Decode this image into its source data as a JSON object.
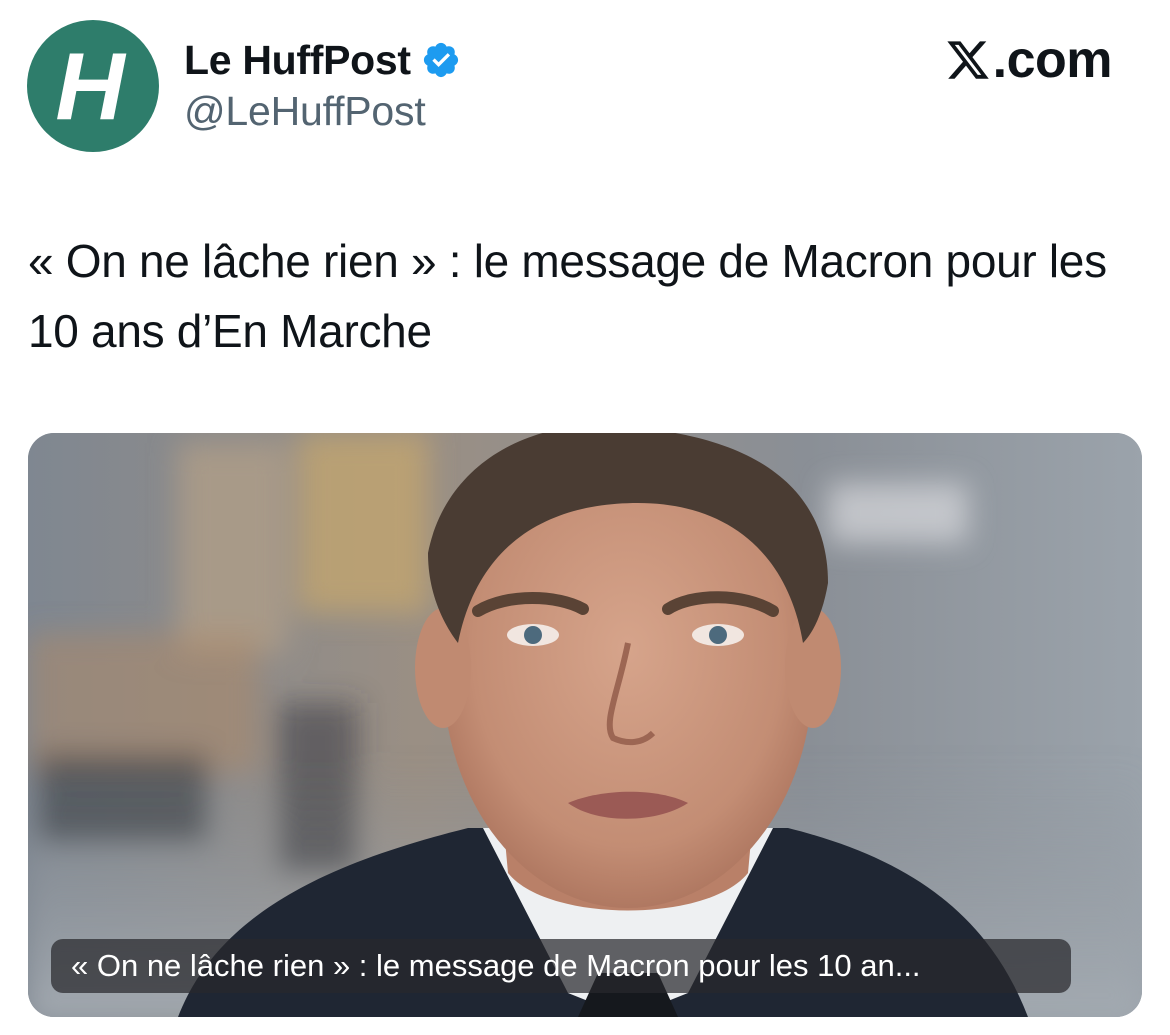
{
  "account": {
    "avatar_letter": "H",
    "avatar_color": "#2e7d6b",
    "display_name": "Le HuffPost",
    "verified": true,
    "verified_color": "#1d9bf0",
    "handle": "@LeHuffPost"
  },
  "brand": {
    "logo_icon": "x-logo-icon",
    "text": ".com"
  },
  "tweet": {
    "text": "« On ne lâche rien » : le message de Macron pour les 10 ans d’En Marche"
  },
  "media": {
    "caption": "« On ne lâche rien » : le message de Macron pour les 10 an..."
  }
}
